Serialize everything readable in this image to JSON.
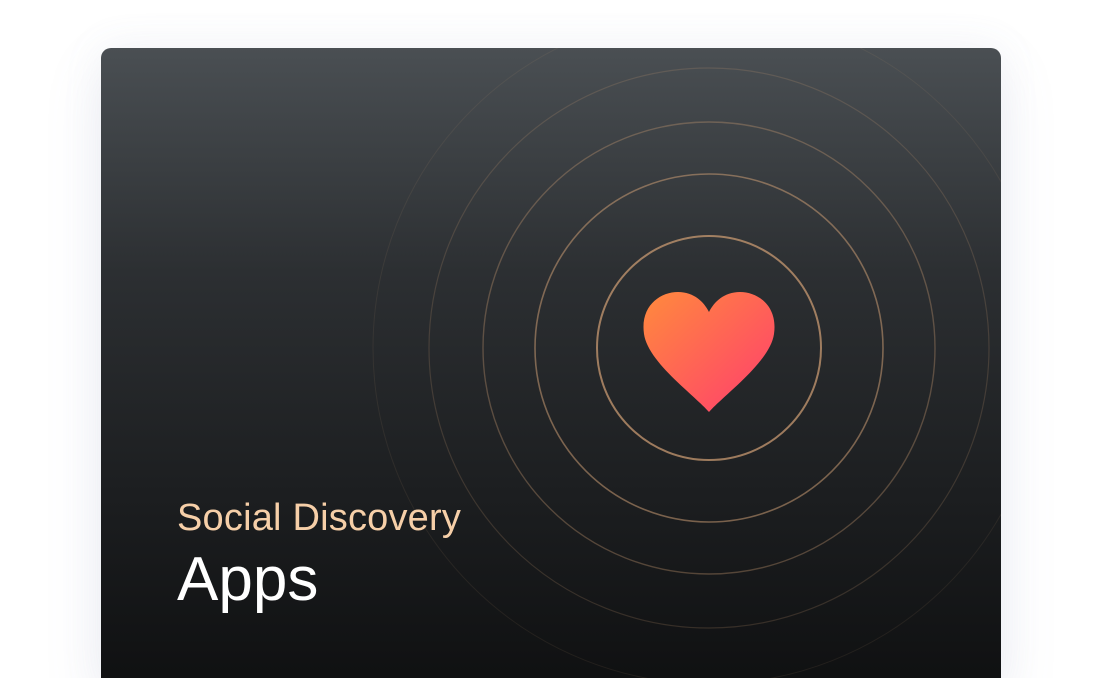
{
  "card": {
    "subtitle": "Social Discovery",
    "title": "Apps",
    "icon": "heart-icon"
  },
  "colors": {
    "subtitle": "#f6cfa8",
    "title": "#ffffff",
    "heart_top": "#ff8a3d",
    "heart_bottom": "#ff3d6e",
    "ring": "#c89a72"
  }
}
